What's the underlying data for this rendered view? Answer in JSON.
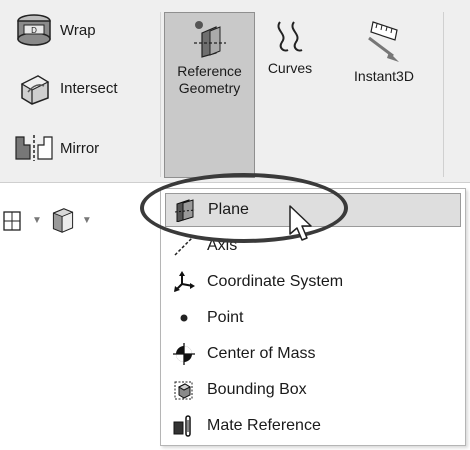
{
  "ribbon": {
    "wrap_label": "Wrap",
    "intersect_label": "Intersect",
    "mirror_label": "Mirror",
    "reference_geometry_line1": "Reference",
    "reference_geometry_line2": "Geometry",
    "curves_label": "Curves",
    "instant3d_label": "Instant3D"
  },
  "menu": {
    "items": [
      {
        "label": "Plane",
        "icon": "plane-icon",
        "highlighted": true
      },
      {
        "label": "Axis",
        "icon": "axis-icon"
      },
      {
        "label": "Coordinate System",
        "icon": "coordinate-system-icon"
      },
      {
        "label": "Point",
        "icon": "point-icon"
      },
      {
        "label": "Center of Mass",
        "icon": "center-of-mass-icon"
      },
      {
        "label": "Bounding Box",
        "icon": "bounding-box-icon"
      },
      {
        "label": "Mate Reference",
        "icon": "mate-reference-icon"
      }
    ]
  },
  "colors": {
    "ribbon_bg": "#efefef",
    "active_button_bg": "#c9c9c9",
    "highlight_item_bg": "#dedede",
    "annotation_ellipse": "#3a3a3a"
  }
}
